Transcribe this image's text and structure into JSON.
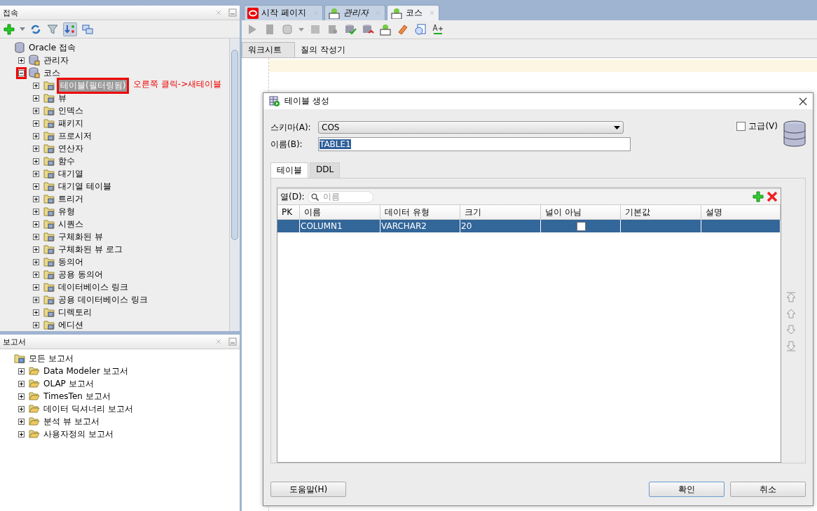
{
  "connections_panel": {
    "title": "접속",
    "annotation": "오른쪽 클릭->새테이블",
    "tree": [
      {
        "label": "Oracle 접속",
        "kind": "root",
        "selected": false,
        "label_boxed": false,
        "children": [
          {
            "label": "관리자",
            "kind": "connection",
            "expanded": false,
            "selected": false,
            "toggle_boxed": false,
            "label_boxed": false
          },
          {
            "label": "코스",
            "kind": "connection",
            "expanded": true,
            "selected": false,
            "toggle_boxed": true,
            "label_boxed": false,
            "children": [
              {
                "label": "테이블(필터링됨)",
                "kind": "folder",
                "expanded": false,
                "selected": true,
                "toggle_boxed": false,
                "label_boxed": true
              },
              {
                "label": "뷰",
                "kind": "folder",
                "expanded": false,
                "selected": false,
                "toggle_boxed": false,
                "label_boxed": false
              },
              {
                "label": "인덱스",
                "kind": "folder",
                "expanded": false,
                "selected": false,
                "toggle_boxed": false,
                "label_boxed": false
              },
              {
                "label": "패키지",
                "kind": "folder",
                "expanded": false,
                "selected": false,
                "toggle_boxed": false,
                "label_boxed": false
              },
              {
                "label": "프로시저",
                "kind": "folder",
                "expanded": false,
                "selected": false,
                "toggle_boxed": false,
                "label_boxed": false
              },
              {
                "label": "연산자",
                "kind": "folder",
                "expanded": false,
                "selected": false,
                "toggle_boxed": false,
                "label_boxed": false
              },
              {
                "label": "함수",
                "kind": "folder",
                "expanded": false,
                "selected": false,
                "toggle_boxed": false,
                "label_boxed": false
              },
              {
                "label": "대기열",
                "kind": "folder",
                "expanded": false,
                "selected": false,
                "toggle_boxed": false,
                "label_boxed": false
              },
              {
                "label": "대기열 테이블",
                "kind": "folder",
                "expanded": false,
                "selected": false,
                "toggle_boxed": false,
                "label_boxed": false
              },
              {
                "label": "트리거",
                "kind": "folder",
                "expanded": false,
                "selected": false,
                "toggle_boxed": false,
                "label_boxed": false
              },
              {
                "label": "유형",
                "kind": "folder",
                "expanded": false,
                "selected": false,
                "toggle_boxed": false,
                "label_boxed": false
              },
              {
                "label": "시퀀스",
                "kind": "folder",
                "expanded": false,
                "selected": false,
                "toggle_boxed": false,
                "label_boxed": false
              },
              {
                "label": "구체화된 뷰",
                "kind": "folder",
                "expanded": false,
                "selected": false,
                "toggle_boxed": false,
                "label_boxed": false
              },
              {
                "label": "구체화된 뷰 로그",
                "kind": "folder",
                "expanded": false,
                "selected": false,
                "toggle_boxed": false,
                "label_boxed": false
              },
              {
                "label": "동의어",
                "kind": "folder",
                "expanded": false,
                "selected": false,
                "toggle_boxed": false,
                "label_boxed": false
              },
              {
                "label": "공용 동의어",
                "kind": "folder",
                "expanded": false,
                "selected": false,
                "toggle_boxed": false,
                "label_boxed": false
              },
              {
                "label": "데이터베이스 링크",
                "kind": "folder",
                "expanded": false,
                "selected": false,
                "toggle_boxed": false,
                "label_boxed": false
              },
              {
                "label": "공용 데이터베이스 링크",
                "kind": "folder",
                "expanded": false,
                "selected": false,
                "toggle_boxed": false,
                "label_boxed": false
              },
              {
                "label": "디렉토리",
                "kind": "folder",
                "expanded": false,
                "selected": false,
                "toggle_boxed": false,
                "label_boxed": false
              },
              {
                "label": "에디션",
                "kind": "folder",
                "expanded": false,
                "selected": false,
                "toggle_boxed": false,
                "label_boxed": false
              }
            ]
          }
        ]
      }
    ]
  },
  "reports_panel": {
    "title": "보고서",
    "tree": [
      {
        "label": "모든 보고서",
        "kind": "reports",
        "selected": false,
        "children": [
          {
            "label": "Data Modeler 보고서",
            "kind": "open-folder",
            "expanded": false,
            "selected": false
          },
          {
            "label": "OLAP 보고서",
            "kind": "open-folder",
            "expanded": false,
            "selected": false
          },
          {
            "label": "TimesTen 보고서",
            "kind": "open-folder",
            "expanded": false,
            "selected": false
          },
          {
            "label": "데이터 딕셔너리 보고서",
            "kind": "open-folder",
            "expanded": false,
            "selected": false
          },
          {
            "label": "분석 뷰 보고서",
            "kind": "open-folder",
            "expanded": false,
            "selected": false
          },
          {
            "label": "사용자정의 보고서",
            "kind": "open-folder",
            "expanded": false,
            "selected": false
          }
        ]
      }
    ]
  },
  "editor_tabs": [
    {
      "label": "시작 페이지",
      "kind": "oracle",
      "selected": false,
      "italic": false
    },
    {
      "label": "관리자",
      "kind": "sql",
      "selected": false,
      "italic": true
    },
    {
      "label": "코스",
      "kind": "sql",
      "selected": true,
      "italic": false
    }
  ],
  "worksheet_tabs": [
    {
      "label": "워크시트",
      "selected": true
    },
    {
      "label": "질의 작성기",
      "selected": false
    }
  ],
  "dialog": {
    "title": "테이블 생성",
    "schema_label": "스키마(A):",
    "schema_value": "COS",
    "name_label": "이름(B):",
    "name_value": "TABLE1",
    "advanced": {
      "label": "고급(V)",
      "checked": false
    },
    "tabs": [
      {
        "label": "테이블",
        "selected": true
      },
      {
        "label": "DDL",
        "selected": false
      }
    ],
    "columns_label": "열(D):",
    "search": {
      "placeholder": "이름"
    },
    "table": {
      "columns": [
        "PK",
        "이름",
        "데이터 유형",
        "크기",
        "널이 아님",
        "기본값",
        "설명"
      ],
      "rows": [
        {
          "name": "COLUMN1",
          "data_type": "VARCHAR2",
          "size": "20",
          "not_null": false,
          "selected": true
        }
      ]
    },
    "buttons": [
      {
        "label": "도움말(H)",
        "kind": "help"
      },
      {
        "label": "확인",
        "kind": "default"
      },
      {
        "label": "취소",
        "kind": "normal"
      }
    ]
  }
}
